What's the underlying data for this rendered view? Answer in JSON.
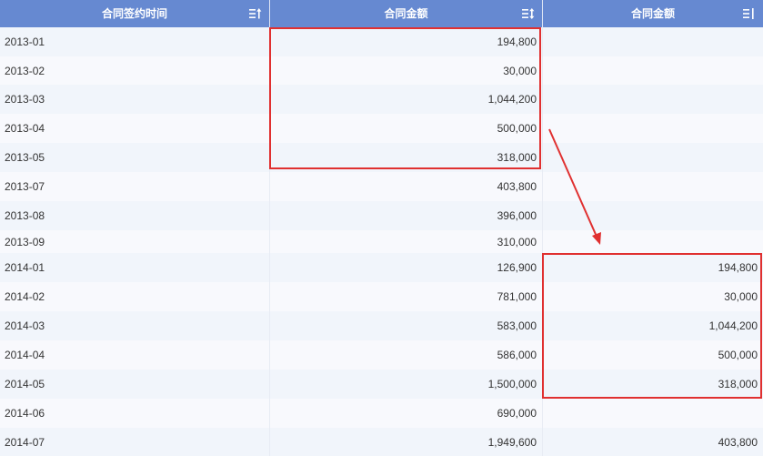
{
  "headers": {
    "col1": "合同签约时间",
    "col2": "合同金额",
    "col3": "合同金额"
  },
  "icons": {
    "col1_sort": "sort-ascending-icon",
    "col2_sort": "sort-both-icon",
    "col3_sort": "sort-icon"
  },
  "rows": [
    {
      "date": "2013-01",
      "amount": "194,800",
      "amount2": ""
    },
    {
      "date": "2013-02",
      "amount": "30,000",
      "amount2": ""
    },
    {
      "date": "2013-03",
      "amount": "1,044,200",
      "amount2": ""
    },
    {
      "date": "2013-04",
      "amount": "500,000",
      "amount2": ""
    },
    {
      "date": "2013-05",
      "amount": "318,000",
      "amount2": ""
    },
    {
      "date": "2013-07",
      "amount": "403,800",
      "amount2": ""
    },
    {
      "date": "2013-08",
      "amount": "396,000",
      "amount2": ""
    },
    {
      "date": "2013-09",
      "amount": "310,000",
      "amount2": ""
    },
    {
      "date": "2014-01",
      "amount": "126,900",
      "amount2": "194,800"
    },
    {
      "date": "2014-02",
      "amount": "781,000",
      "amount2": "30,000"
    },
    {
      "date": "2014-03",
      "amount": "583,000",
      "amount2": "1,044,200"
    },
    {
      "date": "2014-04",
      "amount": "586,000",
      "amount2": "500,000"
    },
    {
      "date": "2014-05",
      "amount": "1,500,000",
      "amount2": "318,000"
    },
    {
      "date": "2014-06",
      "amount": "690,000",
      "amount2": ""
    },
    {
      "date": "2014-07",
      "amount": "1,949,600",
      "amount2": "403,800"
    }
  ],
  "colors": {
    "header_bg": "#6689d1",
    "highlight": "#e03030",
    "row_alt": "#f1f5fb"
  }
}
